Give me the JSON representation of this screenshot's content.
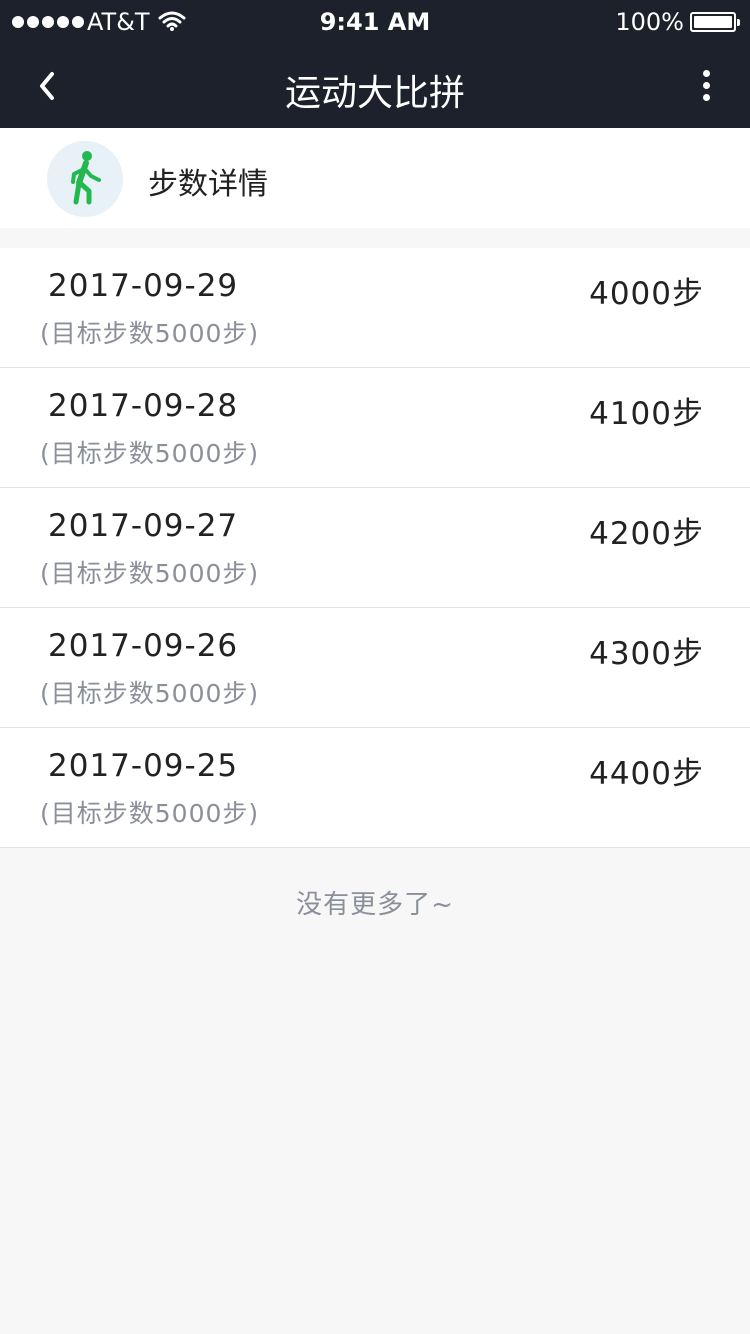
{
  "status_bar": {
    "carrier": "AT&T",
    "time": "9:41 AM",
    "battery": "100%"
  },
  "nav": {
    "title": "运动大比拼"
  },
  "header": {
    "title": "步数详情",
    "icon": "walking-person-icon",
    "icon_color": "#22b84d"
  },
  "records": [
    {
      "date": "2017-09-29",
      "goal": "(目标步数5000步)",
      "steps": "4000步"
    },
    {
      "date": "2017-09-28",
      "goal": "(目标步数5000步)",
      "steps": "4100步"
    },
    {
      "date": "2017-09-27",
      "goal": "(目标步数5000步)",
      "steps": "4200步"
    },
    {
      "date": "2017-09-26",
      "goal": "(目标步数5000步)",
      "steps": "4300步"
    },
    {
      "date": "2017-09-25",
      "goal": "(目标步数5000步)",
      "steps": "4400步"
    }
  ],
  "footer": {
    "note": "没有更多了~"
  },
  "colors": {
    "nav_background": "#1c212b",
    "page_background": "#f7f7f7",
    "muted_text": "#8a8f9a"
  }
}
